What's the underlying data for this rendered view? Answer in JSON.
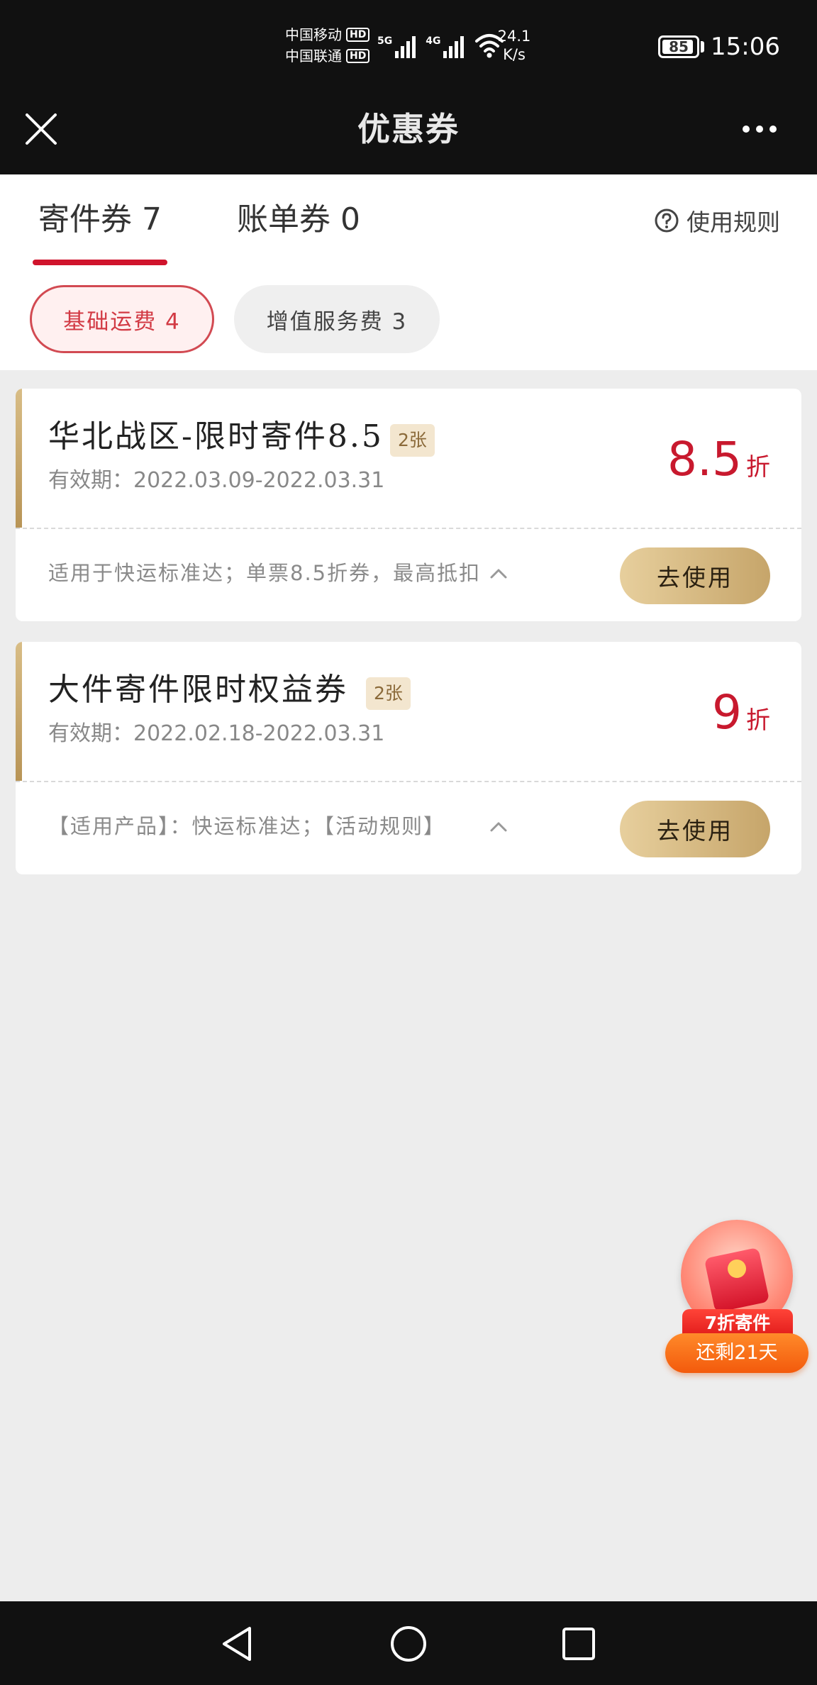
{
  "status_bar": {
    "carrier_1": "中国移动",
    "carrier_2": "中国联通",
    "hd": "HD",
    "net_1": "5G",
    "net_2": "4G",
    "speed_value": "24.1",
    "speed_unit": "K/s",
    "battery": "85",
    "time": "15:06"
  },
  "header": {
    "title": "优惠券",
    "close_icon": "close-icon",
    "more_icon": "more-icon"
  },
  "tabs": [
    {
      "label": "寄件券 7",
      "active": true
    },
    {
      "label": "账单券 0",
      "active": false
    }
  ],
  "rules_link": "使用规则",
  "filters": [
    {
      "label": "基础运费 4",
      "active": true
    },
    {
      "label": "增值服务费 3",
      "active": false
    }
  ],
  "coupons": [
    {
      "name": "华北战区-限时寄件8.5",
      "count": "2张",
      "validity": "有效期：2022.03.09-2022.03.31",
      "discount": "8.5",
      "unit": "折",
      "description": "适用于快运标准达；单票8.5折券，最高抵扣",
      "button": "去使用"
    },
    {
      "name": "大件寄件限时权益券",
      "count": "2张",
      "validity": "有效期：2022.02.18-2022.03.31",
      "discount": "9",
      "unit": "折",
      "description": "【适用产品】：快运标准达；【活动规则】",
      "button": "去使用"
    }
  ],
  "promo": {
    "tag": "7折寄件",
    "days": "还剩21天"
  },
  "colors": {
    "accent_red": "#c8192e",
    "gold_button": "#d6b982",
    "dark_bar": "#111111"
  }
}
